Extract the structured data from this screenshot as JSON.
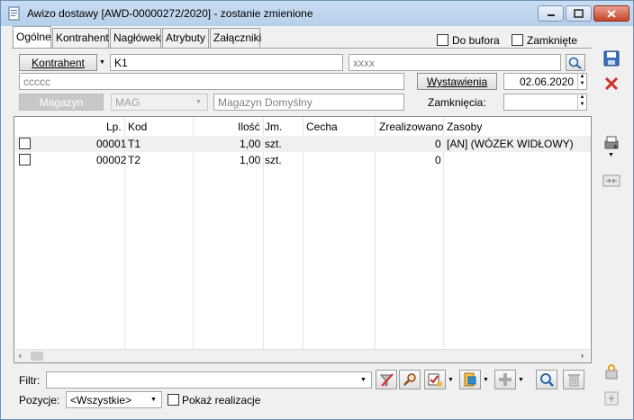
{
  "window": {
    "title": "Awizo dostawy [AWD-00000272/2020]  - zostanie zmienione",
    "icon": "document-icon"
  },
  "tabs": [
    "Ogólne",
    "Kontrahent",
    "Nagłówek",
    "Atrybuty",
    "Załączniki"
  ],
  "header": {
    "do_bufora_label": "Do bufora",
    "do_bufora_checked": false,
    "zamkniete_label": "Zamknięte",
    "zamkniete_checked": false
  },
  "form": {
    "kontrahent_button": "Kontrahent",
    "kontrahent_code": "K1",
    "kontrahent_search": "xxxx",
    "kontrahent_name": "ccccc",
    "wystawienia_button": "Wystawienia",
    "wystawienia_date": "02.06.2020",
    "magazyn_button": "Magazyn",
    "magazyn_code": "MAG",
    "magazyn_name": "Magazyn Domyślny",
    "zamkniecia_label": "Zamknięcia:",
    "zamkniecia_date": ""
  },
  "grid": {
    "columns": [
      "Lp.",
      "Kod",
      "Ilość",
      "Jm.",
      "Cecha",
      "Zrealizowano",
      "Zasoby"
    ],
    "rows": [
      {
        "lp": "00001",
        "kod": "T1",
        "ilosc": "1,00",
        "jm": "szt.",
        "cecha": "",
        "zrealizowano": "0",
        "zasoby": "[AN] (WÓZEK WIDŁOWY)"
      },
      {
        "lp": "00002",
        "kod": "T2",
        "ilosc": "1,00",
        "jm": "szt.",
        "cecha": "",
        "zrealizowano": "0",
        "zasoby": ""
      }
    ]
  },
  "footer": {
    "filtr_label": "Filtr:",
    "filtr_value": "",
    "pozycje_label": "Pozycje:",
    "pozycje_value": "<Wszystkie>",
    "pokaz_label": "Pokaż realizacje",
    "pokaz_checked": false
  },
  "colors": {
    "titlebar": "#c1d6ee",
    "close": "#c7432a",
    "accent": "#1f6fc5"
  }
}
